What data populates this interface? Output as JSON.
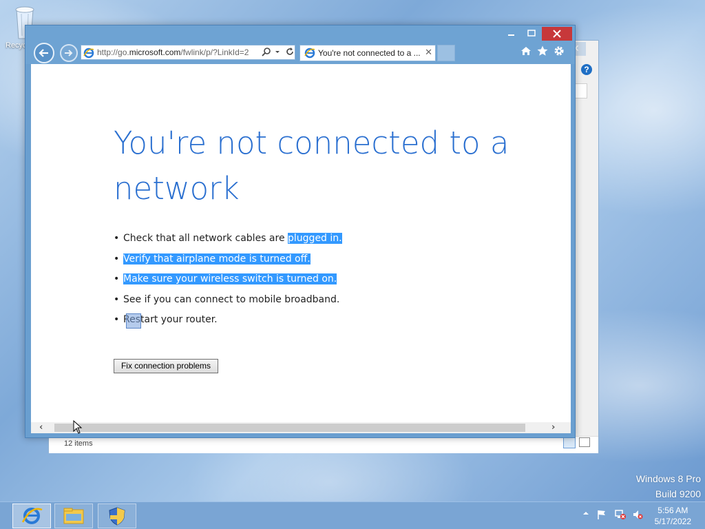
{
  "desktop": {
    "recycle_label": "Recyc",
    "watermark": {
      "edition": "Windows 8 Pro",
      "build": "Build 9200"
    }
  },
  "explorer": {
    "close_glyph": "✕",
    "help_glyph": "?",
    "status_items": "12 items"
  },
  "ie": {
    "address": {
      "prefix": "http://go.",
      "domain": "microsoft.com",
      "path": "/fwlink/p/?LinkId=2"
    },
    "tab_title": "You're not connected to a ...",
    "content": {
      "headline": "You're not connected to a network",
      "bullets": [
        {
          "pre": "Check that all network cables are ",
          "selected": "plugged in.",
          "post": ""
        },
        {
          "pre": "",
          "selected": "Verify that airplane mode is turned off.",
          "post": ""
        },
        {
          "pre": "",
          "selected": "Make sure your wireless switch is turned on.",
          "post": ""
        },
        {
          "pre": "See if you can connect to mobile broadband.",
          "selected": "",
          "post": ""
        },
        {
          "pre": "Restart your router.",
          "selected": "",
          "post": ""
        }
      ],
      "fix_button": "Fix connection problems"
    },
    "icons": {
      "back": "back-arrow-icon",
      "forward": "forward-arrow-icon",
      "home": "home-icon",
      "favorites": "star-icon",
      "tools": "gear-icon"
    },
    "selection_color": "#3399ff",
    "headline_color": "#2a6fd0"
  },
  "taskbar": {
    "items": [
      "internet-explorer",
      "file-explorer",
      "windows-security"
    ],
    "clock": {
      "time": "5:56 AM",
      "date": "5/17/2022"
    }
  }
}
